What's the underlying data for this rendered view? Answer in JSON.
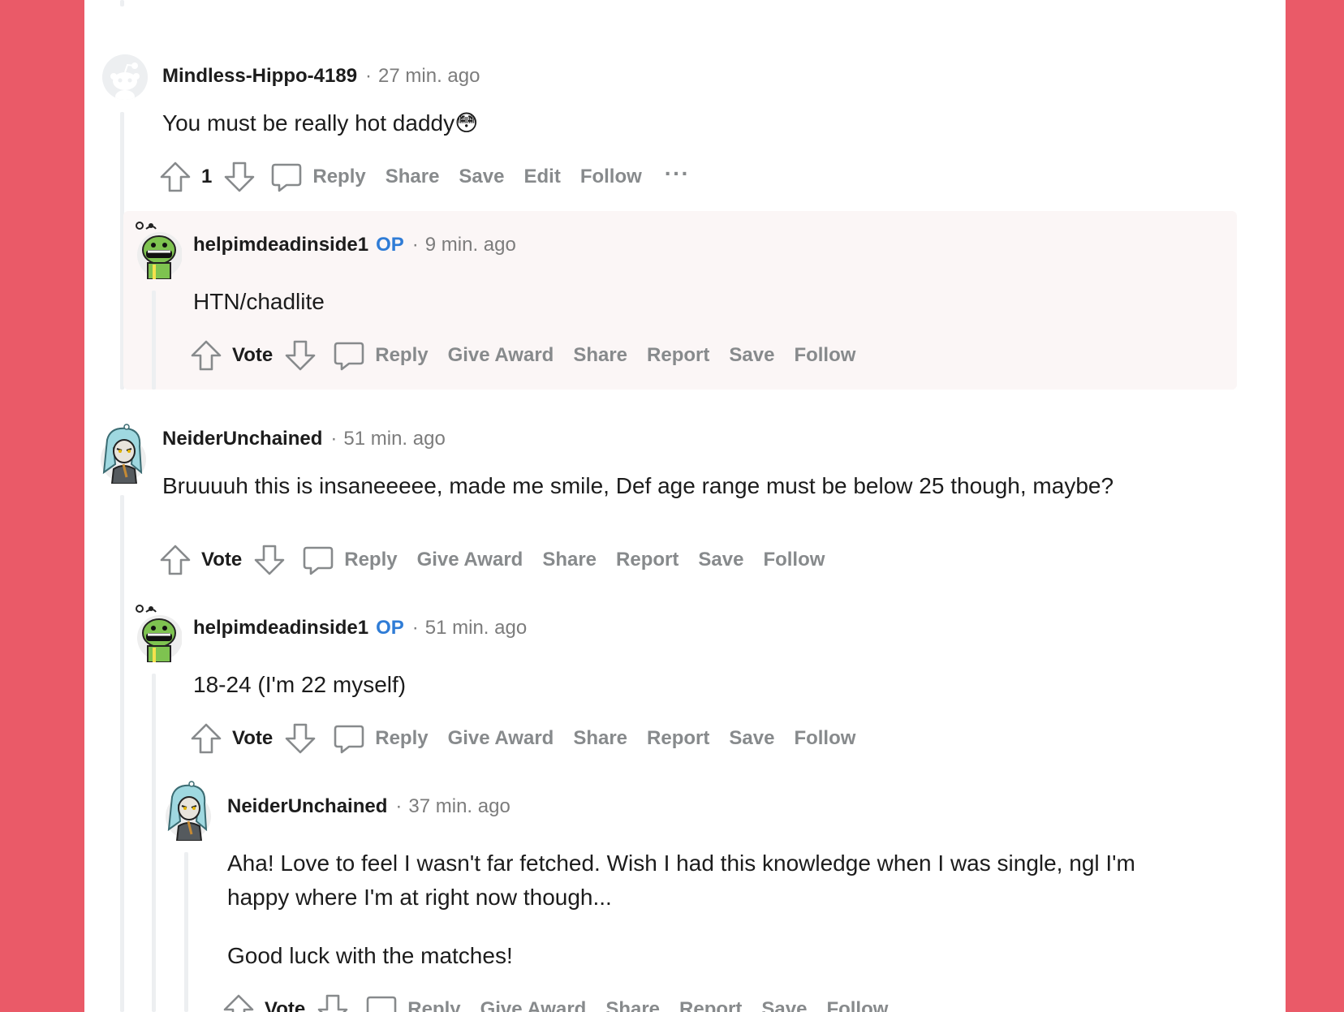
{
  "comments": [
    {
      "username": "Mindless-Hippo-4189",
      "time": "27 min. ago",
      "body": "You must be really hot daddy😳",
      "vote": "1",
      "actions": {
        "reply": "Reply",
        "share": "Share",
        "save": "Save",
        "edit": "Edit",
        "follow": "Follow",
        "more": "···"
      }
    },
    {
      "username": "helpimdeadinside1",
      "op": "OP",
      "time": "9 min. ago",
      "body": "HTN/chadlite",
      "vote": "Vote",
      "actions": {
        "reply": "Reply",
        "award": "Give Award",
        "share": "Share",
        "report": "Report",
        "save": "Save",
        "follow": "Follow"
      }
    },
    {
      "username": "NeiderUnchained",
      "time": "51 min. ago",
      "body": "Bruuuuh this is insaneeeee, made me smile, Def age range must be below 25 though, maybe?",
      "vote": "Vote",
      "actions": {
        "reply": "Reply",
        "award": "Give Award",
        "share": "Share",
        "report": "Report",
        "save": "Save",
        "follow": "Follow"
      }
    },
    {
      "username": "helpimdeadinside1",
      "op": "OP",
      "time": "51 min. ago",
      "body": "18-24 (I'm 22 myself)",
      "vote": "Vote",
      "actions": {
        "reply": "Reply",
        "award": "Give Award",
        "share": "Share",
        "report": "Report",
        "save": "Save",
        "follow": "Follow"
      }
    },
    {
      "username": "NeiderUnchained",
      "time": "37 min. ago",
      "body_lines": [
        "Aha! Love to feel I wasn't far fetched. Wish I had this knowledge when I was single, ngl I'm",
        "happy where I'm at right now though...",
        "Good luck with the matches!"
      ],
      "vote": "Vote",
      "actions": {
        "reply": "Reply",
        "award": "Give Award",
        "share": "Share",
        "report": "Report",
        "save": "Save",
        "follow": "Follow"
      }
    }
  ],
  "colors": {
    "page_bg": "#ea5a68",
    "op_blue": "#2f7cd6",
    "meta_gray": "#7c7c7c",
    "action_gray": "#878a8c"
  },
  "icons": [
    "upvote-icon",
    "downvote-icon",
    "comment-bubble-icon",
    "more-dots-icon",
    "snoo-avatar-icon"
  ]
}
